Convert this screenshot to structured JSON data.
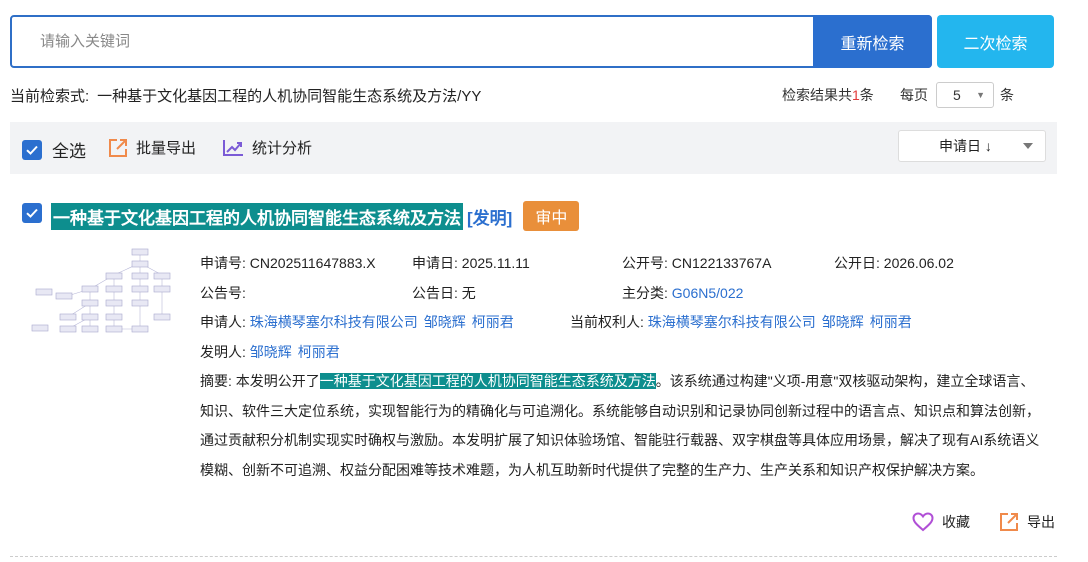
{
  "search": {
    "placeholder": "请输入关键词",
    "research_label": "重新检索",
    "secondary_label": "二次检索"
  },
  "query": {
    "label": "当前检索式:",
    "value": "一种基于文化基因工程的人机协同智能生态系统及方法/YY"
  },
  "results": {
    "prefix": "检索结果共",
    "count": "1",
    "suffix": "条",
    "per_page_label": "每页",
    "per_page_value": "5",
    "per_page_unit": "条"
  },
  "toolbar": {
    "select_all": "全选",
    "batch_export": "批量导出",
    "stats": "统计分析",
    "sort_value": "申请日 ↓"
  },
  "item": {
    "title": "一种基于文化基因工程的人机协同智能生态系统及方法",
    "type": "[发明]",
    "status": "审中",
    "app_no_label": "申请号:",
    "app_no": "CN202511647883.X",
    "app_date_label": "申请日:",
    "app_date": "2025.11.11",
    "pub_no_label": "公开号:",
    "pub_no": "CN122133767A",
    "pub_date_label": "公开日:",
    "pub_date": "2026.06.02",
    "notice_no_label": "公告号:",
    "notice_no": "",
    "notice_date_label": "公告日:",
    "notice_date": "无",
    "main_class_label": "主分类:",
    "main_class": "G06N5/022",
    "applicant_label": "申请人:",
    "applicants": [
      "珠海横琴塞尔科技有限公司",
      "邹晓辉",
      "柯丽君"
    ],
    "owner_label": "当前权利人:",
    "owners": [
      "珠海横琴塞尔科技有限公司",
      "邹晓辉",
      "柯丽君"
    ],
    "inventor_label": "发明人:",
    "inventors": [
      "邹晓辉",
      "柯丽君"
    ],
    "abstract_label": "摘要:",
    "abstract_pre": "本发明公开了",
    "abstract_hl": "一种基于文化基因工程的人机协同智能生态系统及方法",
    "abstract_post": "。该系统通过构建\"义项-用意\"双核驱动架构，建立全球语言、知识、软件三大定位系统，实现智能行为的精确化与可追溯化。系统能够自动识别和记录协同创新过程中的语言点、知识点和算法创新，通过贡献积分机制实现实时确权与激励。本发明扩展了知识体验场馆、智能驻行载器、双字棋盘等具体应用场景，解决了现有AI系统语义模糊、创新不可追溯、权益分配困难等技术难题，为人机互助新时代提供了完整的生产力、生产关系和知识产权保护解决方案。",
    "favorite_label": "收藏",
    "export_label": "导出"
  },
  "colors": {
    "primary": "#2b6fcf",
    "secondary": "#23b6ee",
    "highlight": "#0d8e8e",
    "status": "#e98f3a",
    "count": "#e23b3b",
    "favorite_icon": "#b04fd6",
    "export_icon": "#f08a4b"
  }
}
